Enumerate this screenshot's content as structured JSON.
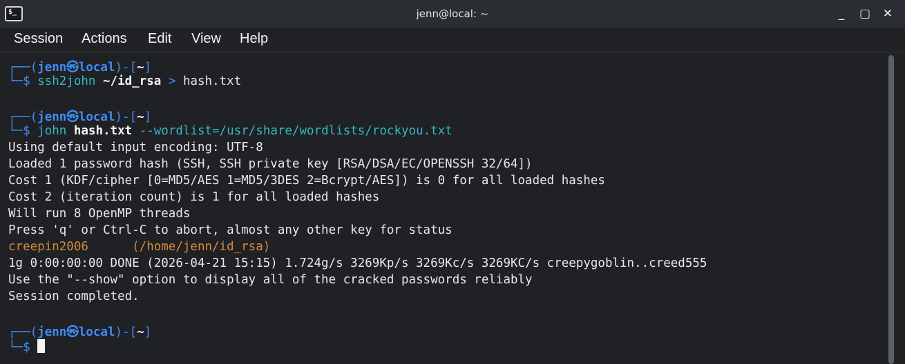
{
  "window": {
    "title": "jenn@local: ~",
    "app_icon_text": "$_",
    "minimize_label": "_",
    "maximize_label": "▢",
    "close_label": "✕"
  },
  "menu": [
    "Session",
    "Actions",
    "Edit",
    "View",
    "Help"
  ],
  "prompt": {
    "user": "jenn",
    "host": "local",
    "dir": "~",
    "corner_top": "┌──(",
    "separator": "㉿",
    "mid": ")-[",
    "end": "]",
    "corner_bottom": "└─$"
  },
  "commands": [
    {
      "name": "ssh2john",
      "arg1": "~/id_rsa",
      "redirect": ">",
      "arg2": "hash.txt"
    },
    {
      "name": "john",
      "arg1": "hash.txt",
      "arg2": "--wordlist=/usr/share/wordlists/rockyou.txt"
    }
  ],
  "output": [
    "Using default input encoding: UTF-8",
    "Loaded 1 password hash (SSH, SSH private key [RSA/DSA/EC/OPENSSH 32/64])",
    "Cost 1 (KDF/cipher [0=MD5/AES 1=MD5/3DES 2=Bcrypt/AES]) is 0 for all loaded hashes",
    "Cost 2 (iteration count) is 1 for all loaded hashes",
    "Will run 8 OpenMP threads",
    "Press 'q' or Ctrl-C to abort, almost any other key for status"
  ],
  "cracked": {
    "password": "creepin2006",
    "path": "(/home/jenn/id_rsa)"
  },
  "output_after": [
    "1g 0:00:00:00 DONE (2026-04-21 15:15) 1.724g/s 3269Kp/s 3269Kc/s 3269KC/s creepygoblin..creed555",
    "Use the \"--show\" option to display all of the cracked passwords reliably",
    "Session completed."
  ]
}
